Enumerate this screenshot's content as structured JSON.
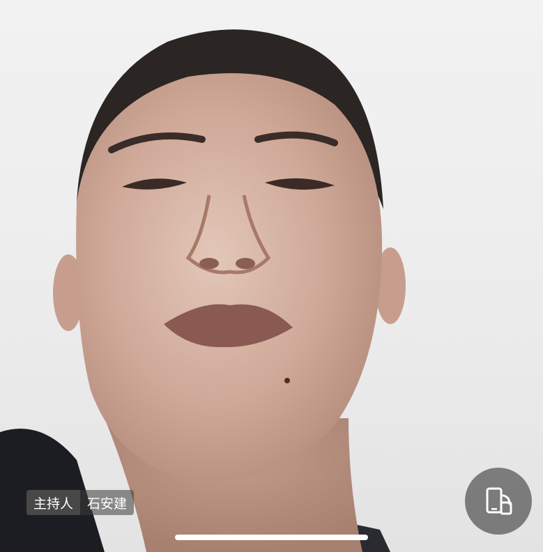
{
  "video": {
    "feed_label": ""
  },
  "participant": {
    "role": "主持人",
    "name": "石安建"
  },
  "controls": {
    "switch_icon": "phone-switch-icon"
  },
  "colors": {
    "label_bg": "#3c3c3c",
    "button_bg": "#696969",
    "indicator": "#ffffff"
  }
}
